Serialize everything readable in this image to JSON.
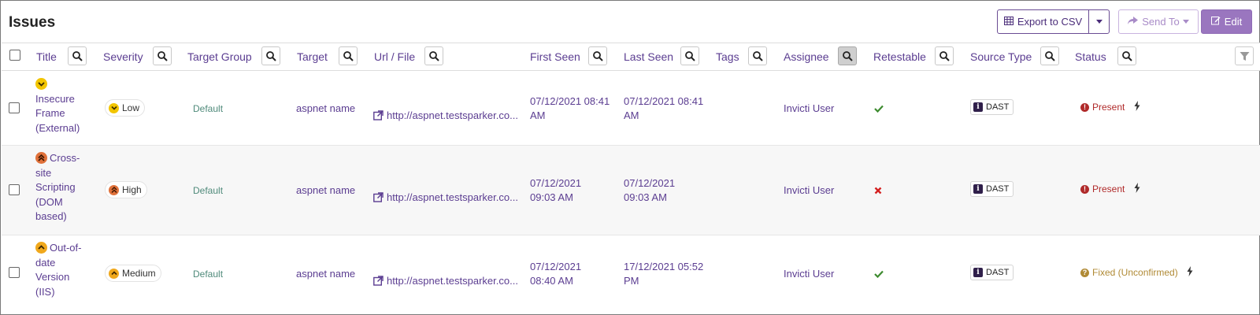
{
  "page": {
    "title": "Issues"
  },
  "toolbar": {
    "export_label": "Export to CSV",
    "send_label": "Send To",
    "edit_label": "Edit"
  },
  "columns": {
    "title": "Title",
    "severity": "Severity",
    "target_group": "Target Group",
    "target": "Target",
    "url": "Url / File",
    "first_seen": "First Seen",
    "last_seen": "Last Seen",
    "tags": "Tags",
    "assignee": "Assignee",
    "retestable": "Retestable",
    "source_type": "Source Type",
    "status": "Status"
  },
  "rows": [
    {
      "title_lines": [
        "Insecure",
        "Frame",
        "(External)"
      ],
      "severity": "Low",
      "severity_icon": "chevron-down-icon",
      "target_group": "Default",
      "target": "aspnet name",
      "url": "http://aspnet.testsparker.co...",
      "first_seen_lines": [
        "07/12/2021 08:41",
        "AM"
      ],
      "last_seen_lines": [
        "07/12/2021 08:41",
        "AM"
      ],
      "assignee": "Invicti User",
      "retestable": "check-icon",
      "source_type": "DAST",
      "status": "Present"
    },
    {
      "title_lines": [
        "Cross-",
        "site",
        "Scripting",
        "(DOM",
        "based)"
      ],
      "severity": "High",
      "severity_icon": "double-chevron-up-icon",
      "target_group": "Default",
      "target": "aspnet name",
      "url": "http://aspnet.testsparker.co...",
      "first_seen_lines": [
        "07/12/2021",
        "09:03 AM"
      ],
      "last_seen_lines": [
        "07/12/2021",
        "09:03 AM"
      ],
      "assignee": "Invicti User",
      "retestable": "cross-icon",
      "source_type": "DAST",
      "status": "Present"
    },
    {
      "title_lines": [
        "Out-of-",
        "date",
        "Version",
        "(IIS)"
      ],
      "severity": "Medium",
      "severity_icon": "chevron-up-icon",
      "target_group": "Default",
      "target": "aspnet name",
      "url": "http://aspnet.testsparker.co...",
      "first_seen_lines": [
        "07/12/2021",
        "08:40 AM"
      ],
      "last_seen_lines": [
        "17/12/2021 05:52",
        "PM"
      ],
      "assignee": "Invicti User",
      "retestable": "check-icon",
      "source_type": "DAST",
      "status": "Fixed (Unconfirmed)"
    }
  ],
  "colors": {
    "accent": "#5b3d91",
    "low": "#f2c500",
    "high": "#e0713a",
    "medium": "#f0a81c",
    "present": "#b02a2a",
    "fixed": "#b08a35",
    "check": "#3d8b2f",
    "cross": "#d42020"
  }
}
